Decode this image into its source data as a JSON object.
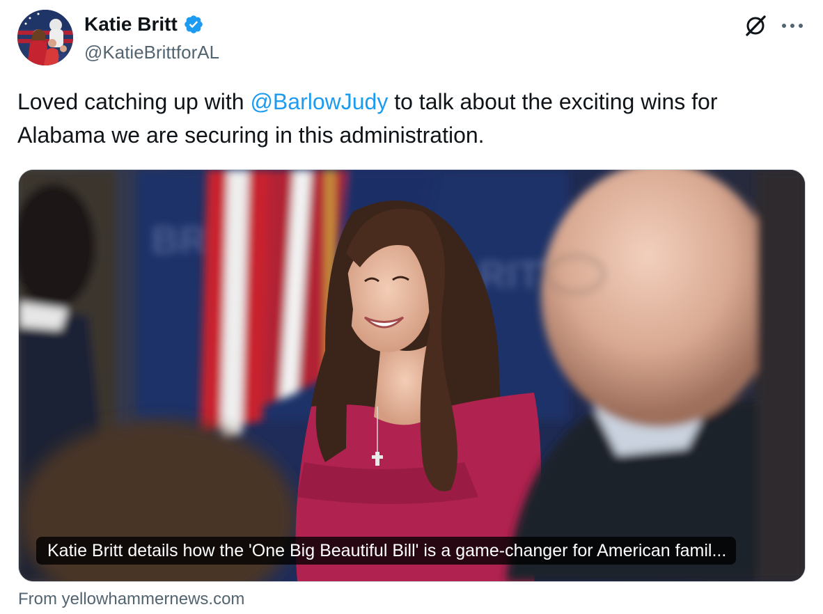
{
  "tweet": {
    "author": {
      "display_name": "Katie Britt",
      "handle": "@KatieBrittforAL",
      "verified": true
    },
    "text_before": "Loved catching up with ",
    "mention": "@BarlowJudy",
    "text_after": " to talk about the exciting wins for Alabama we are securing in this administration.",
    "card": {
      "caption": "Katie Britt details how the 'One Big Beautiful Bill' is a game-changer for American famil...",
      "source": "From yellowhammernews.com"
    },
    "icons": {
      "verified": "verified-badge-icon",
      "grok": "grok-icon",
      "more": "more-options-icon"
    },
    "colors": {
      "accent": "#1d9bf0",
      "text": "#0f1419",
      "secondary": "#536471"
    }
  }
}
